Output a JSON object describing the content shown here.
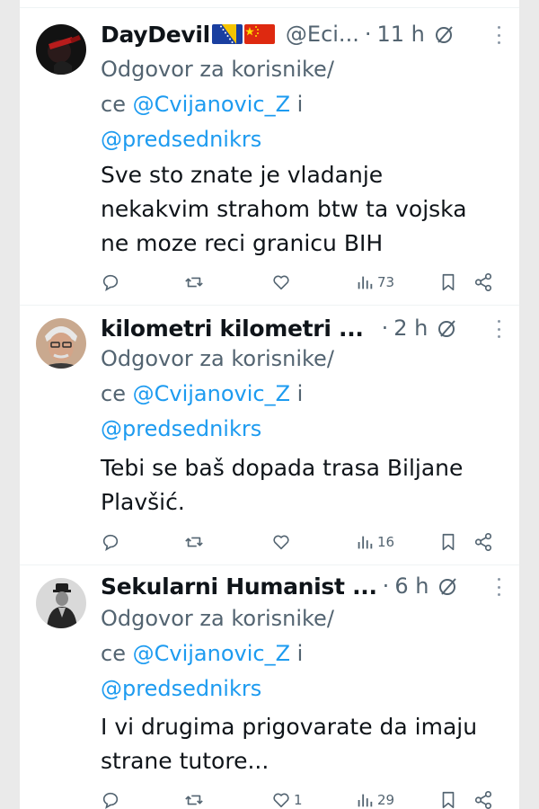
{
  "tweets": [
    {
      "name": "DayDevil",
      "handle": "@Eci...",
      "dot": "·",
      "time": "11 h",
      "flags": [
        "bosnia-flag",
        "china-flag"
      ],
      "reply_prefix": "Odgovor za korisnike/",
      "reply_ce": "ce",
      "mention1": "@Cvijanovic_Z",
      "reply_and": "i",
      "mention2": "@predsednikrs",
      "body_lines": [
        "Sve sto znate je vladanje",
        "nekakvim strahom btw ta vojska",
        "ne moze reci granicu  BIH"
      ],
      "likes": "",
      "views": "73"
    },
    {
      "name": "kilometri kilometri ...",
      "handle": "",
      "dot": "·",
      "time": "2 h",
      "reply_prefix": "Odgovor za korisnike/",
      "reply_ce": "ce",
      "mention1": "@Cvijanovic_Z",
      "reply_and": "i",
      "mention2": "@predsednikrs",
      "body_lines": [
        "Tebi se baš dopada trasa Biljane",
        "Plavšić."
      ],
      "likes": "",
      "views": "16"
    },
    {
      "name": "Sekularni Humanist ...",
      "handle": "",
      "dot": "·",
      "time": "6 h",
      "reply_prefix": "Odgovor za korisnike/",
      "reply_ce": "ce",
      "mention1": "@Cvijanovic_Z",
      "reply_and": "i",
      "mention2": "@predsednikrs",
      "body_lines": [
        "I vi drugima prigovarate da imaju",
        "strane tutore..."
      ],
      "likes": "1",
      "views": "29"
    }
  ],
  "icons": {
    "reply": "reply-icon",
    "retweet": "retweet-icon",
    "like": "heart-icon",
    "views": "views-icon",
    "bookmark": "bookmark-icon",
    "share": "share-icon",
    "grok": "grok-icon",
    "more": "more-icon"
  },
  "colors": {
    "mention": "#1d9bf0",
    "secondary": "#536471",
    "text": "#0f1419"
  }
}
